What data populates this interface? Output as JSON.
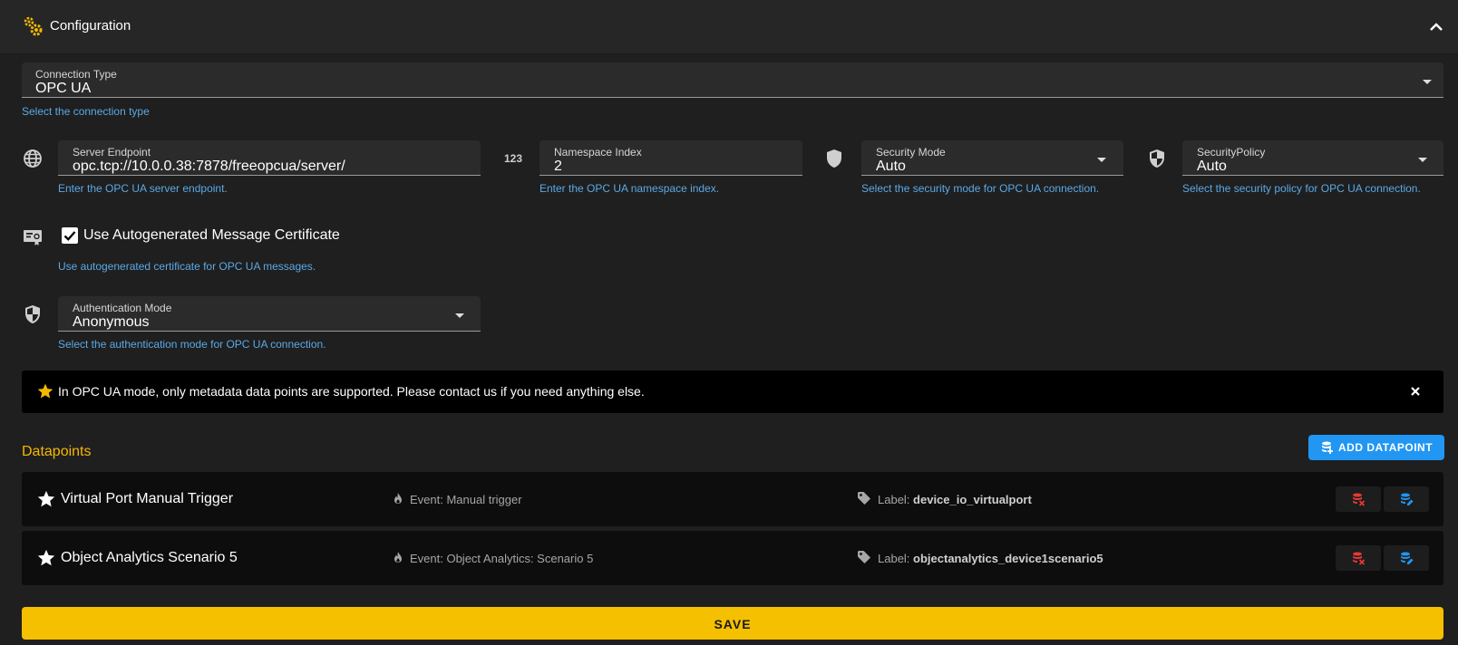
{
  "header": {
    "title": "Configuration"
  },
  "connection": {
    "label": "Connection Type",
    "value": "OPC UA",
    "hint": "Select the connection type"
  },
  "server": {
    "label": "Server Endpoint",
    "value": "opc.tcp://10.0.0.38:7878/freeopcua/server/",
    "hint": "Enter the OPC UA server endpoint."
  },
  "namespace": {
    "icon_text": "123",
    "label": "Namespace Index",
    "value": "2",
    "hint": "Enter the OPC UA namespace index."
  },
  "security_mode": {
    "label": "Security Mode",
    "value": "Auto",
    "hint": "Select the security mode for OPC UA connection."
  },
  "security_policy": {
    "label": "SecurityPolicy",
    "value": "Auto",
    "hint": "Select the security policy for OPC UA connection."
  },
  "certificate": {
    "label": "Use Autogenerated Message Certificate",
    "checked": true,
    "hint": "Use autogenerated certificate for OPC UA messages."
  },
  "auth": {
    "label": "Authentication Mode",
    "value": "Anonymous",
    "hint": "Select the authentication mode for OPC UA connection."
  },
  "alert": {
    "message": "In OPC UA mode, only metadata data points are supported. Please contact us if you need anything else."
  },
  "datapoints": {
    "title": "Datapoints",
    "add_label": "ADD DATAPOINT",
    "items": [
      {
        "name": "Virtual Port Manual Trigger",
        "event": "Event: Manual trigger",
        "label_prefix": "Label:",
        "label_value": "device_io_virtualport"
      },
      {
        "name": "Object Analytics Scenario 5",
        "event": "Event: Object Analytics: Scenario 5",
        "label_prefix": "Label:",
        "label_value": "objectanalytics_device1scenario5"
      }
    ]
  },
  "save_label": "SAVE",
  "colors": {
    "background": "#1f1f1f",
    "accent": "#f5c000",
    "link": "#5aa9e6",
    "primary_button": "#2196f3",
    "danger": "#e53935"
  },
  "icons": {
    "header": "gears-icon",
    "globe": "globe-icon",
    "shield": "shield-icon",
    "certificate": "certificate-icon",
    "star": "star-icon",
    "flame": "flame-icon",
    "tag": "tag-icon",
    "delete": "database-remove-icon",
    "edit": "database-edit-icon"
  }
}
